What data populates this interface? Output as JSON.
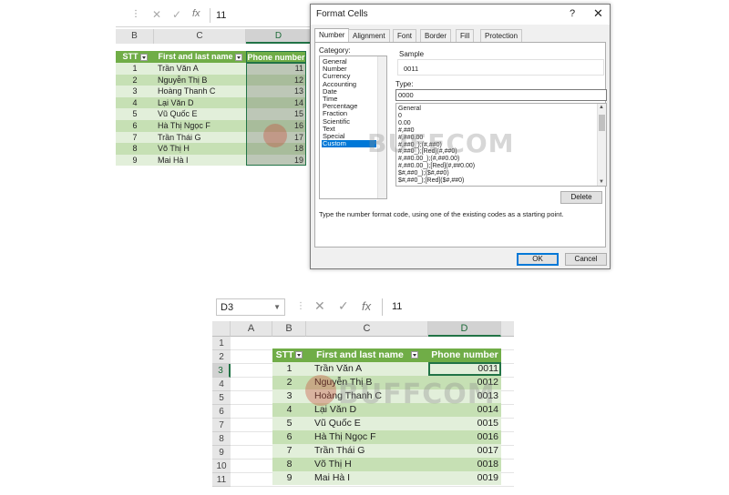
{
  "top_sheet": {
    "formula_value": "11",
    "fx_label": "fx",
    "columns": [
      "B",
      "C",
      "D"
    ],
    "headers": [
      "STT",
      "First and last name",
      "Phone number"
    ],
    "rows": [
      {
        "stt": "1",
        "name": "Trần Văn A",
        "phone": "11"
      },
      {
        "stt": "2",
        "name": "Nguyễn Thị B",
        "phone": "12"
      },
      {
        "stt": "3",
        "name": "Hoàng Thanh C",
        "phone": "13"
      },
      {
        "stt": "4",
        "name": "Lại Văn D",
        "phone": "14"
      },
      {
        "stt": "5",
        "name": "Vũ Quốc E",
        "phone": "15"
      },
      {
        "stt": "6",
        "name": "Hà Thị Ngọc F",
        "phone": "16"
      },
      {
        "stt": "7",
        "name": "Trần Thái G",
        "phone": "17"
      },
      {
        "stt": "8",
        "name": "Võ Thị H",
        "phone": "18"
      },
      {
        "stt": "9",
        "name": "Mai Hà I",
        "phone": "19"
      }
    ]
  },
  "dialog": {
    "title": "Format Cells",
    "help": "?",
    "close": "✕",
    "tabs": [
      "Number",
      "Alignment",
      "Font",
      "Border",
      "Fill",
      "Protection"
    ],
    "category_label": "Category:",
    "categories": [
      "General",
      "Number",
      "Currency",
      "Accounting",
      "Date",
      "Time",
      "Percentage",
      "Fraction",
      "Scientific",
      "Text",
      "Special",
      "Custom"
    ],
    "selected_category": "Custom",
    "sample_label": "Sample",
    "sample_value": "0011",
    "type_label": "Type:",
    "type_value": "0000",
    "formats": [
      "General",
      "0",
      "0.00",
      "#,##0",
      "#,##0.00",
      "#,##0_);(#,##0)",
      "#,##0_);[Red](#,##0)",
      "#,##0.00_);(#,##0.00)",
      "#,##0.00_);[Red](#,##0.00)",
      "$#,##0_);($#,##0)",
      "$#,##0_);[Red]($#,##0)"
    ],
    "delete_label": "Delete",
    "hint": "Type the number format code, using one of the existing codes as a starting point.",
    "ok_label": "OK",
    "cancel_label": "Cancel"
  },
  "bottom_sheet": {
    "name_box": "D3",
    "formula_value": "11",
    "fx_label": "fx",
    "columns": [
      "A",
      "B",
      "C",
      "D"
    ],
    "row_numbers": [
      "1",
      "2",
      "3",
      "4",
      "5",
      "6",
      "7",
      "8",
      "9",
      "10",
      "11"
    ],
    "headers": [
      "STT",
      "First and last name",
      "Phone number"
    ],
    "rows": [
      {
        "stt": "1",
        "name": "Trần Văn A",
        "phone": "0011"
      },
      {
        "stt": "2",
        "name": "Nguyễn Thị B",
        "phone": "0012"
      },
      {
        "stt": "3",
        "name": "Hoàng Thanh C",
        "phone": "0013"
      },
      {
        "stt": "4",
        "name": "Lại Văn D",
        "phone": "0014"
      },
      {
        "stt": "5",
        "name": "Vũ Quốc E",
        "phone": "0015"
      },
      {
        "stt": "6",
        "name": "Hà Thị Ngọc F",
        "phone": "0016"
      },
      {
        "stt": "7",
        "name": "Trần Thái G",
        "phone": "0017"
      },
      {
        "stt": "8",
        "name": "Võ Thị H",
        "phone": "0018"
      },
      {
        "stt": "9",
        "name": "Mai Hà I",
        "phone": "0019"
      }
    ]
  },
  "watermark": "BUFFCOM",
  "colors": {
    "header_green": "#70ad47",
    "band_light": "#e2efda",
    "band_dark": "#c6e0b4",
    "excel_green": "#217346",
    "selection_blue": "#0078d7"
  }
}
